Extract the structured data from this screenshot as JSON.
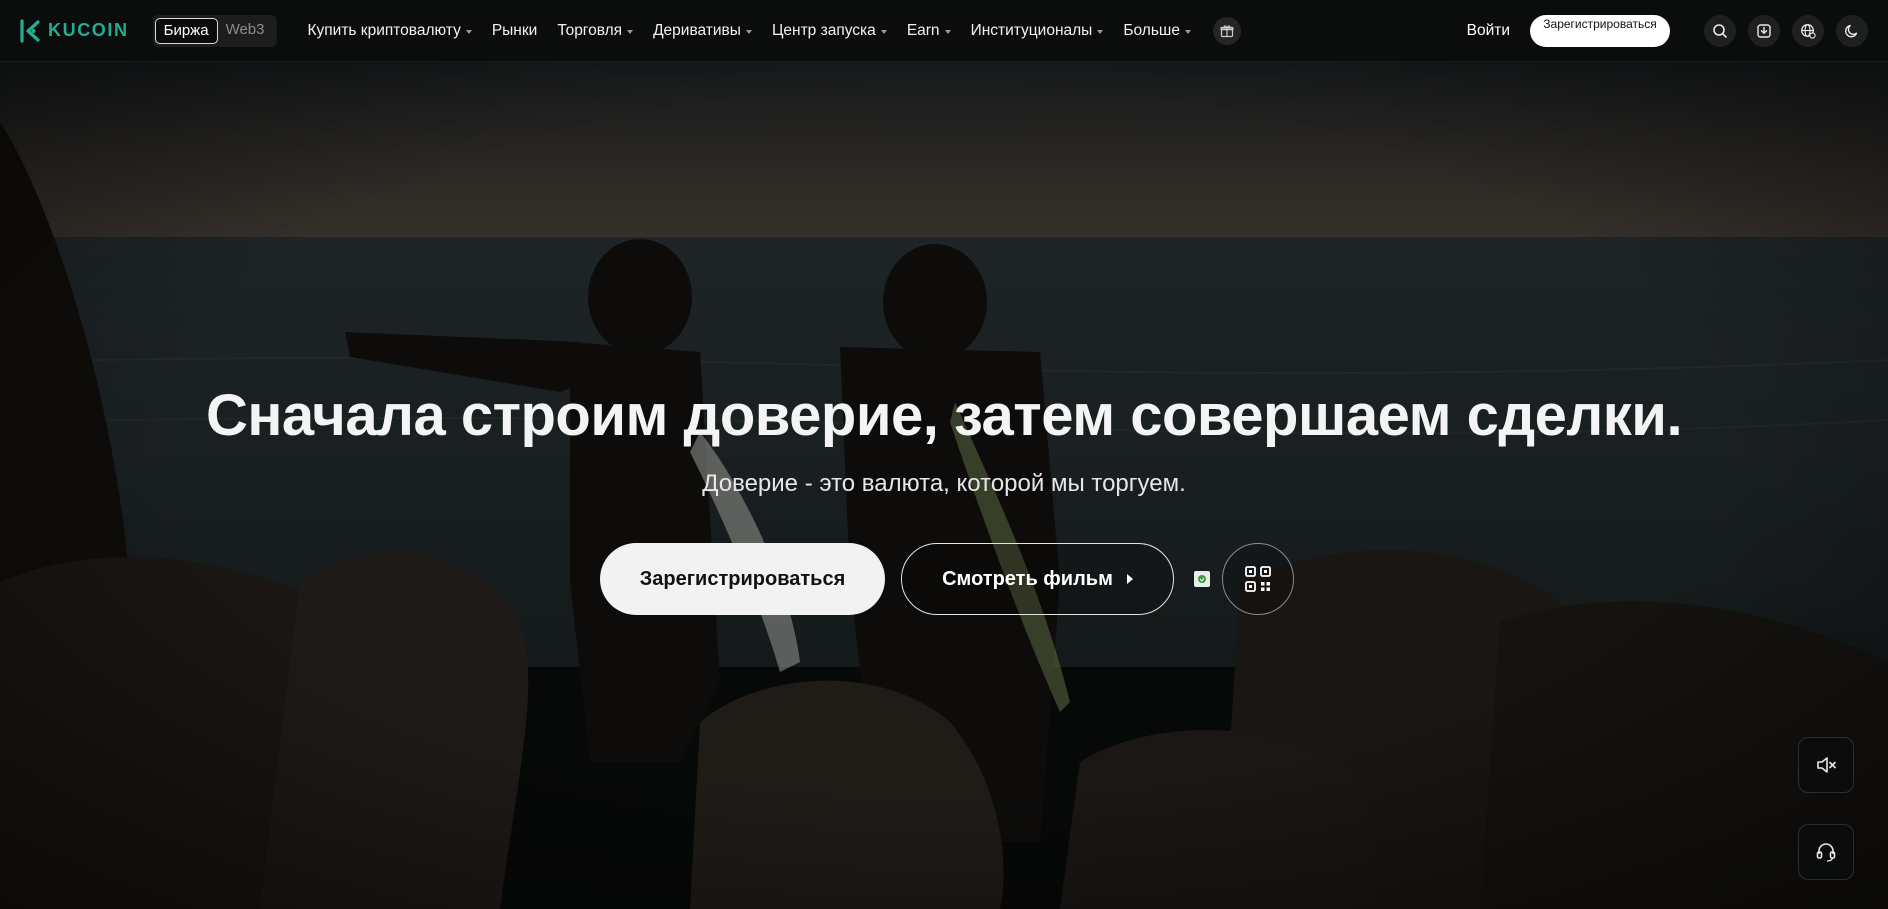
{
  "brand": {
    "name": "KUCOIN",
    "accent": "#24ae8f"
  },
  "switch": {
    "active_label": "Биржа",
    "inactive_label": "Web3"
  },
  "nav": {
    "items": [
      {
        "label": "Купить криптовалюту",
        "dropdown": true
      },
      {
        "label": "Рынки",
        "dropdown": false
      },
      {
        "label": "Торговля",
        "dropdown": true
      },
      {
        "label": "Деривативы",
        "dropdown": true
      },
      {
        "label": "Центр запуска",
        "dropdown": true
      },
      {
        "label": "Earn",
        "dropdown": true
      },
      {
        "label": "Институционалы",
        "dropdown": true
      },
      {
        "label": "Больше",
        "dropdown": true
      }
    ],
    "gift_icon": "gift-icon"
  },
  "header_right": {
    "login_label": "Войти",
    "signup_label": "Зарегистрироваться",
    "icons": [
      "search-icon",
      "download-icon",
      "globe-icon",
      "moon-icon"
    ]
  },
  "hero": {
    "headline": "Сначала строим доверие, затем совершаем сделки.",
    "subline": "Доверие - это валюта, которой мы торгуем.",
    "primary_cta": "Зарегистрироваться",
    "secondary_cta": "Смотреть фильм",
    "qr_icon": "qr-code-icon"
  },
  "floating": {
    "mute_icon": "mute-icon",
    "support_icon": "headset-icon"
  }
}
